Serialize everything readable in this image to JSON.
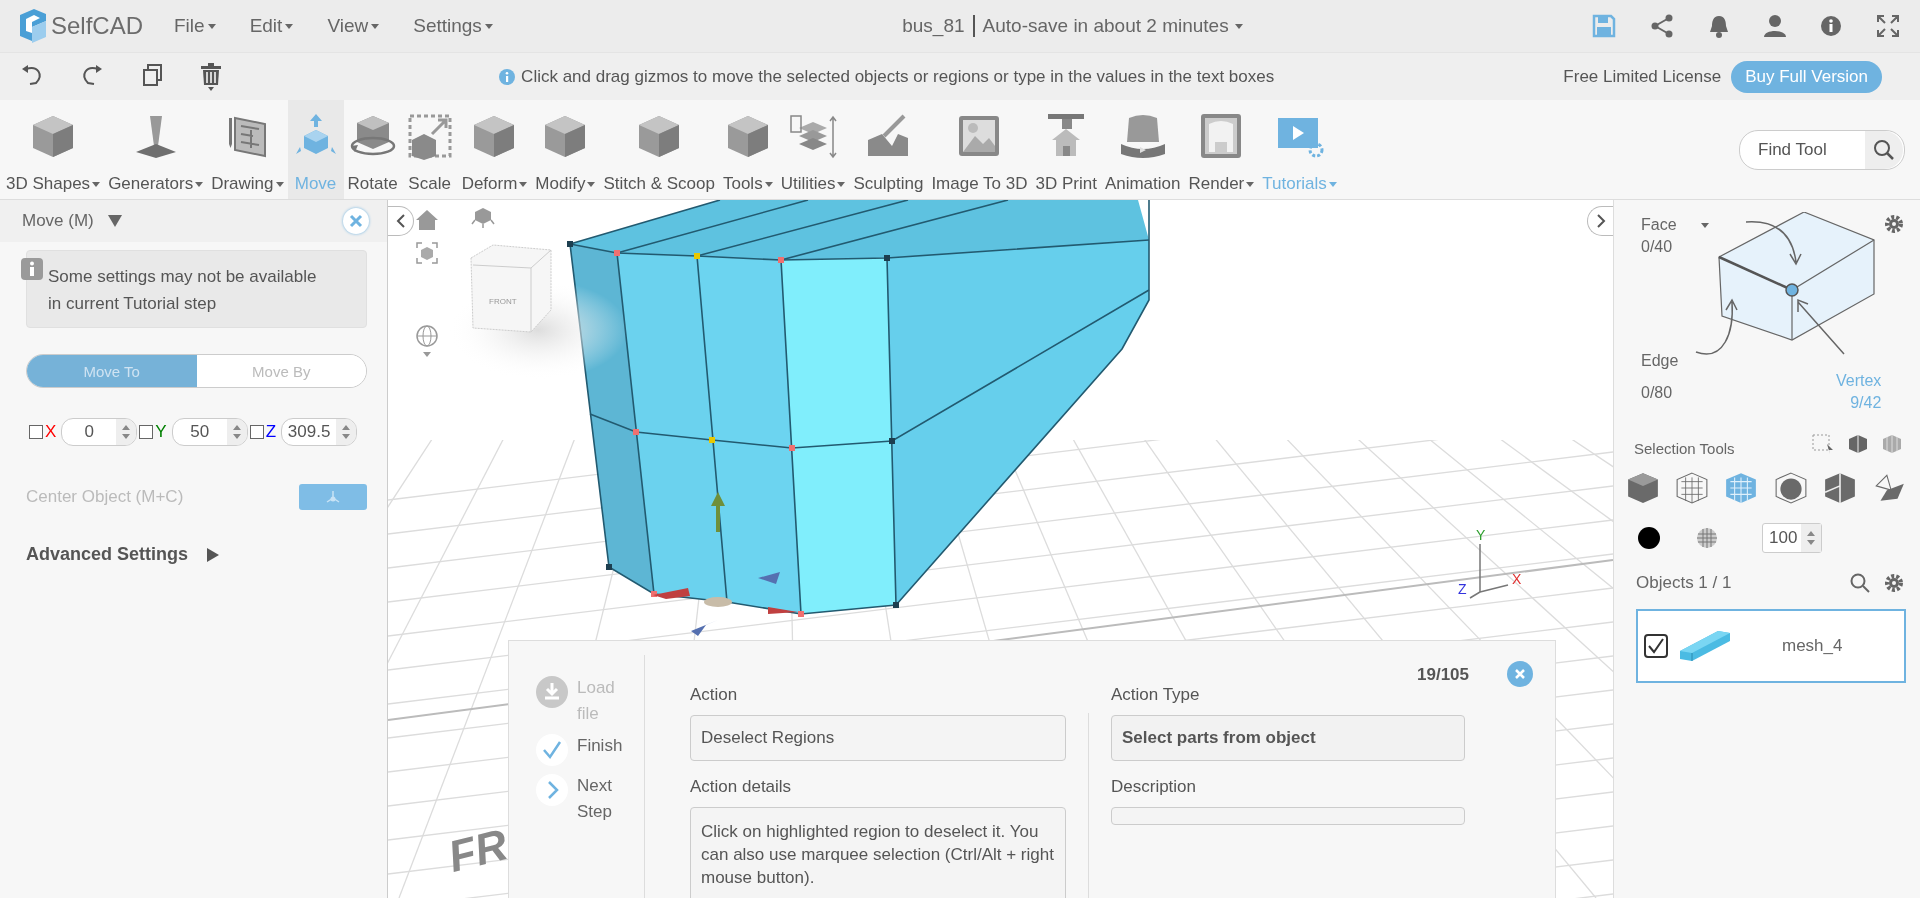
{
  "app": {
    "logo": "SelfCAD",
    "menus": [
      {
        "label": "File"
      },
      {
        "label": "Edit"
      },
      {
        "label": "View"
      },
      {
        "label": "Settings"
      }
    ]
  },
  "document": {
    "title": "bus_81",
    "autosave": "Auto-save in about 2 minutes"
  },
  "toolbar": {
    "hint": "Click and drag gizmos to move the selected objects or regions or type in the values in the text boxes",
    "license": "Free Limited License",
    "buy_button": "Buy Full Version"
  },
  "tools": [
    {
      "label": "3D Shapes",
      "dropdown": true,
      "selected": false,
      "highlighted": false
    },
    {
      "label": "Generators",
      "dropdown": true,
      "selected": false,
      "highlighted": false
    },
    {
      "label": "Drawing",
      "dropdown": true,
      "selected": false,
      "highlighted": false
    },
    {
      "label": "Move",
      "dropdown": false,
      "selected": true,
      "highlighted": false
    },
    {
      "label": "Rotate",
      "dropdown": false,
      "selected": false,
      "highlighted": false
    },
    {
      "label": "Scale",
      "dropdown": false,
      "selected": false,
      "highlighted": false
    },
    {
      "label": "Deform",
      "dropdown": true,
      "selected": false,
      "highlighted": false
    },
    {
      "label": "Modify",
      "dropdown": true,
      "selected": false,
      "highlighted": false
    },
    {
      "label": "Stitch & Scoop",
      "dropdown": false,
      "selected": false,
      "highlighted": false
    },
    {
      "label": "Tools",
      "dropdown": true,
      "selected": false,
      "highlighted": false
    },
    {
      "label": "Utilities",
      "dropdown": true,
      "selected": false,
      "highlighted": false
    },
    {
      "label": "Sculpting",
      "dropdown": false,
      "selected": false,
      "highlighted": false
    },
    {
      "label": "Image To 3D",
      "dropdown": false,
      "selected": false,
      "highlighted": false
    },
    {
      "label": "3D Print",
      "dropdown": false,
      "selected": false,
      "highlighted": false
    },
    {
      "label": "Animation",
      "dropdown": false,
      "selected": false,
      "highlighted": false
    },
    {
      "label": "Render",
      "dropdown": true,
      "selected": false,
      "highlighted": false
    },
    {
      "label": "Tutorials",
      "dropdown": true,
      "selected": false,
      "highlighted": true
    }
  ],
  "find_tool": {
    "placeholder": "Find Tool"
  },
  "left_panel": {
    "title": "Move (M)",
    "notice": "Some settings may not be available in current Tutorial step",
    "modes": [
      {
        "label": "Move To",
        "selected": true
      },
      {
        "label": "Move By",
        "selected": false
      }
    ],
    "axes": [
      {
        "axis": "X",
        "color": "#ff0000",
        "checked": false,
        "value": "0"
      },
      {
        "axis": "Y",
        "color": "#008000",
        "checked": false,
        "value": "50"
      },
      {
        "axis": "Z",
        "color": "#0000ff",
        "checked": false,
        "value": "309.5"
      }
    ],
    "center_object": {
      "label": "Center Object (M+C)",
      "disabled": true
    },
    "advanced": {
      "label": "Advanced Settings",
      "expanded": false
    }
  },
  "viewport": {
    "cube_label": "FRONT",
    "floor_label": "FR",
    "axis_labels": [
      {
        "label": "Y",
        "color": "#2e9e2e"
      },
      {
        "label": "Z",
        "color": "#3333dd"
      },
      {
        "label": "X",
        "color": "#e03030"
      }
    ]
  },
  "tutorial": {
    "steps": [
      {
        "kind": "download",
        "label": "Load file",
        "disabled": true
      },
      {
        "kind": "check",
        "label": "Finish",
        "disabled": false
      },
      {
        "kind": "next",
        "label": "Next Step",
        "disabled": false
      }
    ],
    "counter": "19/105",
    "action_label": "Action",
    "action": "Deselect Regions",
    "details_label": "Action details",
    "details": "Click on highlighted region to deselect it. You can also use marquee selection (Ctrl/Alt + right mouse button).",
    "type_label": "Action Type",
    "type": "Select parts from object",
    "description_label": "Description"
  },
  "right_panel": {
    "selection_modes": [
      {
        "label": "Face",
        "count": "0/40",
        "selected": false,
        "dropdown": true
      },
      {
        "label": "Edge",
        "count": "0/80",
        "selected": false,
        "dropdown": false
      },
      {
        "label": "Vertex",
        "count": "9/42",
        "selected": true,
        "dropdown": false
      }
    ],
    "selection_tools_label": "Selection Tools",
    "selection_tools": [
      {
        "selected": false
      },
      {
        "selected": false
      },
      {
        "selected": true
      },
      {
        "selected": false
      },
      {
        "selected": false
      },
      {
        "selected": false
      }
    ],
    "material": {
      "color": "#000000",
      "opacity": "100"
    },
    "objects": {
      "title": "Objects 1 / 1",
      "items": [
        {
          "name": "mesh_4",
          "checked": true,
          "selected": true
        }
      ]
    }
  }
}
